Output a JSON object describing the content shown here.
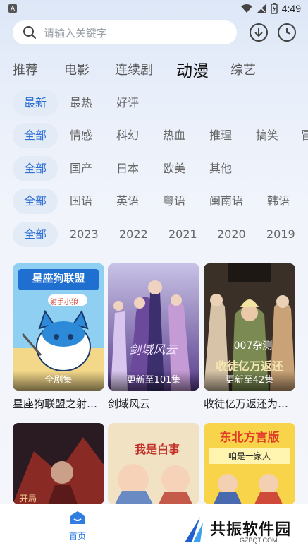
{
  "status_bar": {
    "app_badge": "A",
    "time": "4:49"
  },
  "search": {
    "placeholder": "请输入关键字"
  },
  "category_tabs": [
    {
      "label": "推荐",
      "active": false
    },
    {
      "label": "电影",
      "active": false
    },
    {
      "label": "连续剧",
      "active": false
    },
    {
      "label": "动漫",
      "active": true
    },
    {
      "label": "综艺",
      "active": false
    }
  ],
  "filters": {
    "sort": [
      "最新",
      "最热",
      "好评"
    ],
    "genre": [
      "全部",
      "情感",
      "科幻",
      "热血",
      "推理",
      "搞笑",
      "冒"
    ],
    "region": [
      "全部",
      "国产",
      "日本",
      "欧美",
      "其他"
    ],
    "language": [
      "全部",
      "国语",
      "英语",
      "粤语",
      "闽南语",
      "韩语"
    ],
    "year": [
      "全部",
      "2023",
      "2022",
      "2021",
      "2020",
      "2019"
    ]
  },
  "cards": [
    {
      "title": "星座狗联盟之射…",
      "badge": "全剧集",
      "poster_text": "星座狗联盟",
      "poster_sub": "射手小狼"
    },
    {
      "title": "剑域风云",
      "badge": "更新至101集",
      "poster_text": "剑域风云",
      "poster_sub": ""
    },
    {
      "title": "收徒亿万返还为…",
      "badge": "更新至42集",
      "poster_text": "收徒亿万返还",
      "poster_sub": "007杂测"
    },
    {
      "title": "",
      "badge": "",
      "poster_text": "开局",
      "poster_sub": ""
    },
    {
      "title": "",
      "badge": "",
      "poster_text": "我是白事",
      "poster_sub": ""
    },
    {
      "title": "",
      "badge": "",
      "poster_text": "东北方言版",
      "poster_sub": "咱是一家人"
    }
  ],
  "bottom_nav": {
    "home_label": "首页"
  },
  "watermark": {
    "text": "共振软件园",
    "sub": "GZBQT.COM"
  },
  "colors": {
    "accent": "#2f6fd4",
    "chip_bg": "#e3ebf7",
    "nav_active": "#2f7de1"
  }
}
